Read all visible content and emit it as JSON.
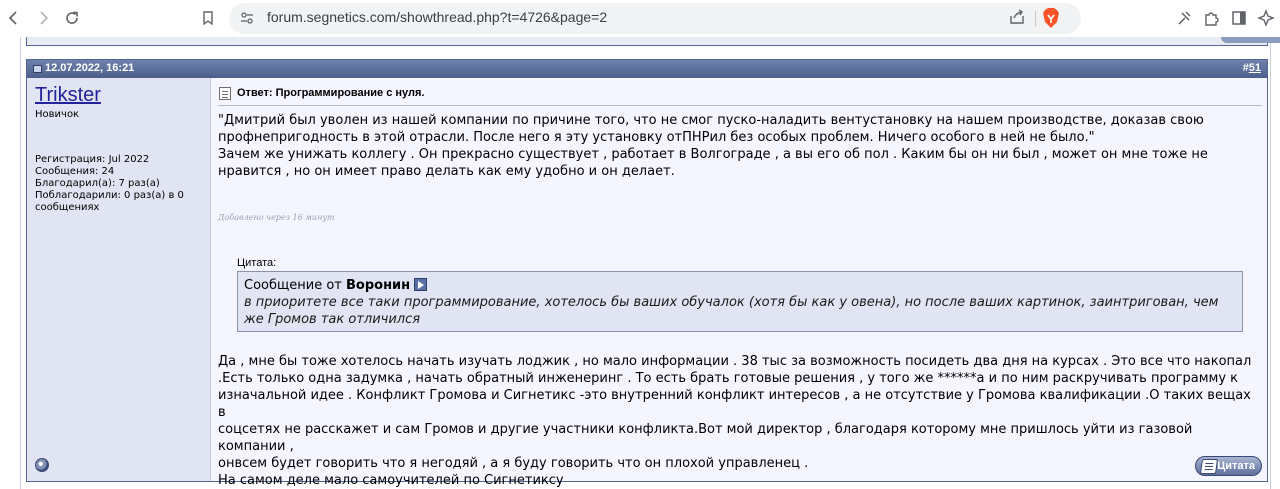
{
  "browser": {
    "url": "forum.segnetics.com/showthread.php?t=4726&page=2",
    "icons": [
      "back-icon",
      "forward-icon",
      "reload-icon",
      "bookmark-icon",
      "site-settings-icon",
      "share-icon",
      "brave-shields-icon",
      "tools-icon",
      "extensions-icon",
      "sidebar-icon",
      "leo-ai-icon"
    ]
  },
  "post": {
    "date": "12.07.2022, 16:21",
    "number_prefix": "#",
    "number": "51",
    "user": {
      "name": "Trikster",
      "title": "Новичок",
      "registration": "Регистрация: Jul 2022",
      "messages": "Сообщения: 24",
      "thanked": "Благодарил(а): 7 раз(а)",
      "was_thanked": "Поблагодарили: 0 раз(а) в 0 сообщениях"
    },
    "title": "Ответ: Программирование с нуля.",
    "body_paragraphs": [
      "\"Дмитрий был уволен из нашей компании по причине того, что не смог пуско-наладить вентустановку на нашем производстве, доказав свою профнепригодность в этой отрасли. После него я эту установку отПНРил без особых проблем. Ничего особого в ней не было.\"",
      "Зачем же унижать коллегу . Он прекрасно существует , работает в Волгограде , а вы его об пол . Каким бы он ни был , может он мне тоже не нравится , но он имеет право делать как ему удобно и он делает."
    ],
    "added_note": "Добавлено через 16 минут",
    "quote": {
      "label": "Цитата:",
      "from_prefix": "Сообщение от",
      "author": "Воронин",
      "text": "в приоритете все таки программирование, хотелось бы ваших обучалок (хотя бы как у овена), но после ваших картинок, заинтригован, чем же Громов так отличился"
    },
    "body2_lines": [
      "Да , мне бы тоже хотелось начать изучать лоджик , но мало информации . 38 тыс за возможность посидеть два дня на курсах . Это все что накопал",
      ".Есть только одна задумка , начать обратный инженеринг . То есть брать готовые решения , у того же ******а и по ним раскручивать программу к",
      "изначальной идее . Конфликт Громова и Сигнетикс -это внутренний конфликт интересов , а не отсутствие у Громова квалификации .О таких вещах в",
      "соцсетях не расскажет и сам Громов и другие участники конфликта.Вот мой директор , благодаря которому мне пришлось уйти из газовой компании ,",
      "онвсем будет говорить что я негодяй , а я буду говорить что он плохой управленец .",
      "На самом деле мало самоучителей по Сигнетиксу"
    ],
    "quote_button_label": "Цитата"
  }
}
